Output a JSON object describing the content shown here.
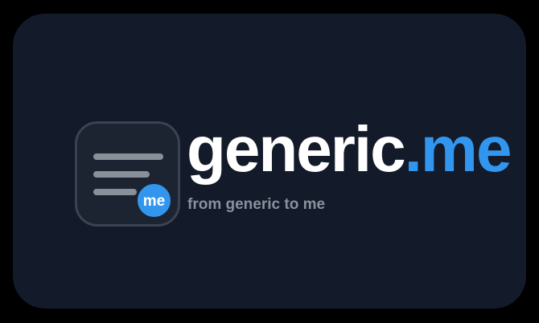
{
  "brand": {
    "name_main": "generic",
    "name_accent": ".me",
    "tagline": "from generic to me",
    "badge_text": "me",
    "logo_icon": "document-lines-icon"
  },
  "colors": {
    "background": "#000000",
    "card": "#131a29",
    "accent": "#3296ee",
    "text_primary": "#ffffff",
    "text_secondary": "#8a909c",
    "icon_lines": "#8a9099"
  }
}
